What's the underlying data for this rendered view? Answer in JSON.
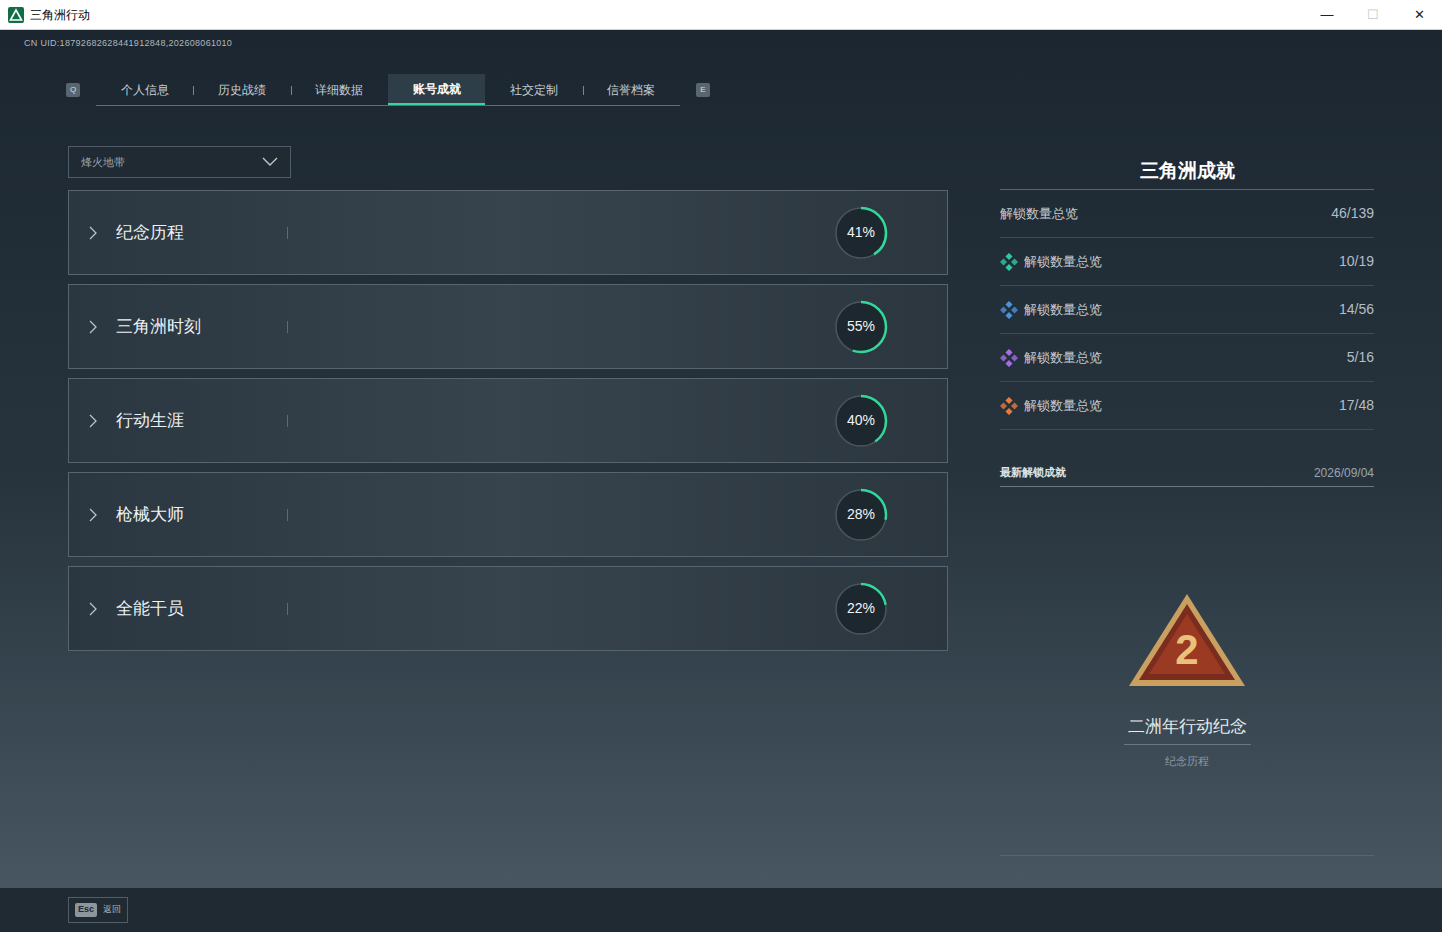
{
  "window": {
    "title": "三角洲行动",
    "controls": [
      "—",
      "☐",
      "✕"
    ]
  },
  "uid": "CN UID:18792682628441912848,202608061010",
  "tab_keys": {
    "left": "Q",
    "right": "E"
  },
  "tabs": [
    {
      "label": "个人信息",
      "selected": false
    },
    {
      "label": "历史战绩",
      "selected": false
    },
    {
      "label": "详细数据",
      "selected": false
    },
    {
      "label": "账号成就",
      "selected": true
    },
    {
      "label": "社交定制",
      "selected": false
    },
    {
      "label": "信誉档案",
      "selected": false
    }
  ],
  "mode_dropdown": {
    "value": "烽火地带",
    "expanded": false
  },
  "categories": [
    {
      "name": "纪念历程",
      "percent": "41%",
      "level": 0.41
    },
    {
      "name": "三角洲时刻",
      "percent": "55%",
      "level": 0.55
    },
    {
      "name": "行动生涯",
      "percent": "40%",
      "level": 0.4
    },
    {
      "name": "枪械大师",
      "percent": "28%",
      "level": 0.28
    },
    {
      "name": "全能干员",
      "percent": "22%",
      "level": 0.22
    }
  ],
  "summary": {
    "title": "三角洲成就",
    "total": {
      "label": "解锁数量总览",
      "value": "46/139"
    },
    "tiers": [
      {
        "label": "解锁数量总览",
        "value": "10/19",
        "color": "#2fc8a2"
      },
      {
        "label": "解锁数量总览",
        "value": "14/56",
        "color": "#4a92dc"
      },
      {
        "label": "解锁数量总览",
        "value": "5/16",
        "color": "#a46ee6"
      },
      {
        "label": "解锁数量总览",
        "value": "17/48",
        "color": "#e47c3c"
      }
    ]
  },
  "latest": {
    "heading": "最新解锁成就",
    "date": "2026/09/04",
    "emblem_text": "2",
    "name": "二洲年行动纪念",
    "category": "纪念历程"
  },
  "footer": {
    "key": "Esc",
    "label": "返回"
  }
}
